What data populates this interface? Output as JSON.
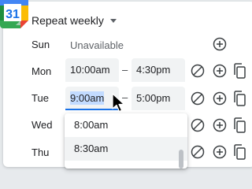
{
  "app": {
    "icon_text": "31",
    "icon": "google-calendar-icon"
  },
  "header": {
    "title": "Repeat weekly"
  },
  "days": {
    "sun": {
      "label": "Sun",
      "status": "Unavailable"
    },
    "mon": {
      "label": "Mon",
      "start": "10:00am",
      "end": "4:30pm"
    },
    "tue": {
      "label": "Tue",
      "start": "9:00am",
      "end": "5:00pm"
    },
    "wed": {
      "label": "Wed"
    },
    "thu": {
      "label": "Thu"
    }
  },
  "separator": "–",
  "dropdown": {
    "options": [
      "8:00am",
      "8:30am"
    ]
  },
  "colors": {
    "accent": "#1a73e8",
    "selection": "#c2dbff"
  }
}
